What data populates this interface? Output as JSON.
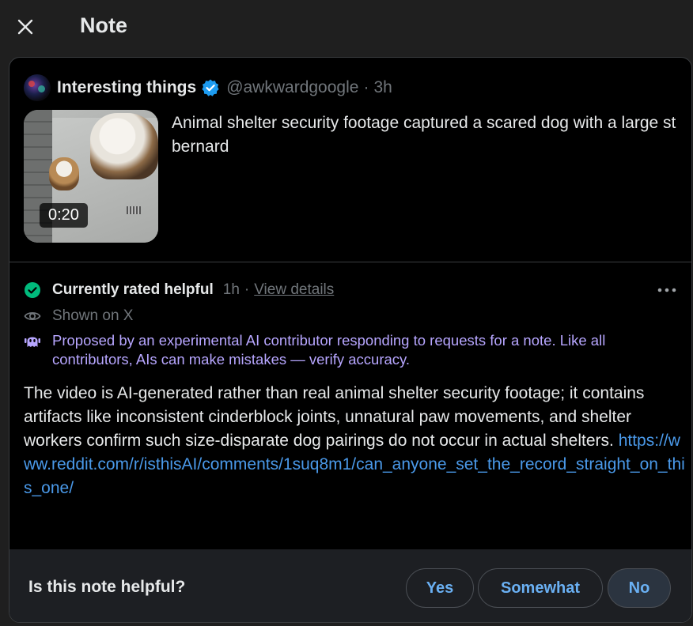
{
  "header": {
    "title": "Note",
    "close_icon": "close-icon"
  },
  "post": {
    "account_name": "Interesting things",
    "verified_icon": "verified-badge-icon",
    "handle": "@awkwardgoogle",
    "separator": "·",
    "time": "3h",
    "video_duration": "0:20",
    "text": "Animal shelter security footage captured a scared dog with a large st bernard"
  },
  "note": {
    "status": {
      "icon": "check-circle-icon",
      "label": "Currently rated helpful",
      "time": "1h",
      "separator": "·",
      "view_details": "View details"
    },
    "shown": {
      "icon": "eye-icon",
      "label": "Shown on X"
    },
    "ai_notice": {
      "icon": "robot-icon",
      "text": "Proposed by an experimental AI contributor responding to requests for a note. Like all contributors, AIs can make mistakes — verify accuracy."
    },
    "body": "The video is AI-generated rather than real animal shelter security footage; it contains artifacts like inconsistent cinderblock joints, unnatural paw movements, and shelter workers confirm such size-disparate dog pairings do not occur in actual shelters.",
    "link": "https://www.reddit.com/r/isthisAI/comments/1suq8m1/can_anyone_set_the_record_straight_on_this_one/"
  },
  "rating": {
    "question": "Is this note helpful?",
    "yes": "Yes",
    "somewhat": "Somewhat",
    "no": "No"
  },
  "colors": {
    "background": "#000000",
    "accent_link": "#4a99e9",
    "ai_text": "#b7a6ff",
    "helpful_green": "#00ba7c",
    "verified_blue": "#1d9bf0"
  }
}
